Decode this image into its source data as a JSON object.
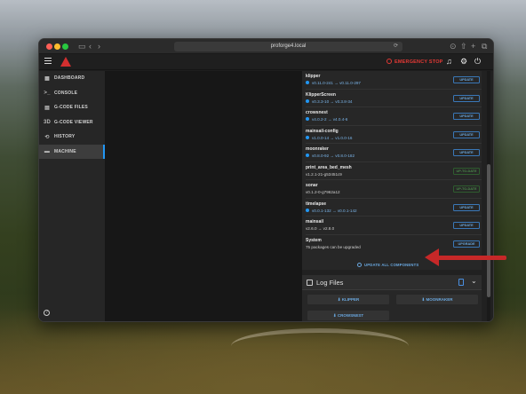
{
  "browser": {
    "url": "proforge4.local"
  },
  "appbar": {
    "estop_label": "EMERGENCY STOP"
  },
  "sidebar": {
    "items": [
      {
        "label": "DASHBOARD",
        "icon": "dashboard-icon"
      },
      {
        "label": "CONSOLE",
        "icon": "console-icon"
      },
      {
        "label": "G-CODE FILES",
        "icon": "file-icon"
      },
      {
        "label": "G-CODE VIEWER",
        "icon": "3d-icon"
      },
      {
        "label": "HISTORY",
        "icon": "history-icon"
      },
      {
        "label": "MACHINE",
        "icon": "machine-icon",
        "active": true
      }
    ]
  },
  "updates": {
    "components": [
      {
        "name": "klipper",
        "version": "v0.11.0-241 → v0.11.0-297",
        "action": "UPDATE"
      },
      {
        "name": "KlipperScreen",
        "version": "v0.3.3-10 → v0.3.8-34",
        "action": "UPDATE"
      },
      {
        "name": "crowsnest",
        "version": "v4.0.2-2 → v4.0.4-6",
        "action": "UPDATE"
      },
      {
        "name": "mainsail-config",
        "version": "v1.0.0-14 → v1.0.0-16",
        "action": "UPDATE"
      },
      {
        "name": "moonraker",
        "version": "v0.8.0-92 → v0.8.0-182",
        "action": "UPDATE"
      },
      {
        "name": "print_area_bed_mesh",
        "version": "v1.2.1-21-g53451c9",
        "action": "UP-TO-DATE"
      },
      {
        "name": "sonar",
        "version": "v0.1.2-0-g7962a12",
        "action": "UP-TO-DATE"
      },
      {
        "name": "timelapse",
        "version": "v0.0.1-132 → v0.0.1-142",
        "action": "UPDATE"
      },
      {
        "name": "mainsail",
        "version": "v2.6.0 → v2.8.0",
        "action": "UPDATE"
      },
      {
        "name": "System",
        "version": "75 packages can be upgraded",
        "action": "UPGRADE"
      }
    ],
    "update_all_label": "UPDATE ALL COMPONENTS"
  },
  "logs": {
    "title": "Log Files",
    "buttons": [
      "KLIPPER",
      "MOONRAKER",
      "CROWSNEST"
    ]
  },
  "colors": {
    "accent": "#2196f3",
    "estop": "#e53935",
    "annotation_arrow": "#c62828"
  }
}
